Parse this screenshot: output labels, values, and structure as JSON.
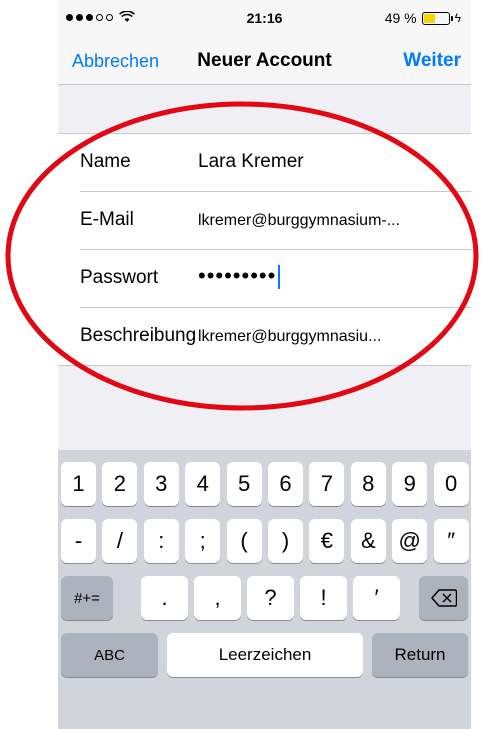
{
  "status": {
    "time": "21:16",
    "battery_text": "49 %",
    "battery_level": 0.49
  },
  "nav": {
    "cancel": "Abbrechen",
    "title": "Neuer Account",
    "next": "Weiter"
  },
  "form": [
    {
      "label": "Name",
      "value": "Lara Kremer"
    },
    {
      "label": "E-Mail",
      "value": "lkremer@burggymnasium-..."
    },
    {
      "label": "Passwort",
      "value": "•••••••••"
    },
    {
      "label": "Beschreibung",
      "value": "lkremer@burggymnasiu..."
    }
  ],
  "keyboard": {
    "row1": [
      "1",
      "2",
      "3",
      "4",
      "5",
      "6",
      "7",
      "8",
      "9",
      "0"
    ],
    "row2": [
      "-",
      "/",
      ":",
      ";",
      "(",
      ")",
      "€",
      "&",
      "@",
      "″"
    ],
    "row3": {
      "shift": "#+=",
      "keys": [
        ".",
        ",",
        "?",
        "!",
        "′"
      ]
    },
    "row4": {
      "abc": "ABC",
      "space": "Leerzeichen",
      "return": "Return"
    }
  },
  "colors": {
    "accent": "#007aff",
    "annotation": "#e30613"
  }
}
